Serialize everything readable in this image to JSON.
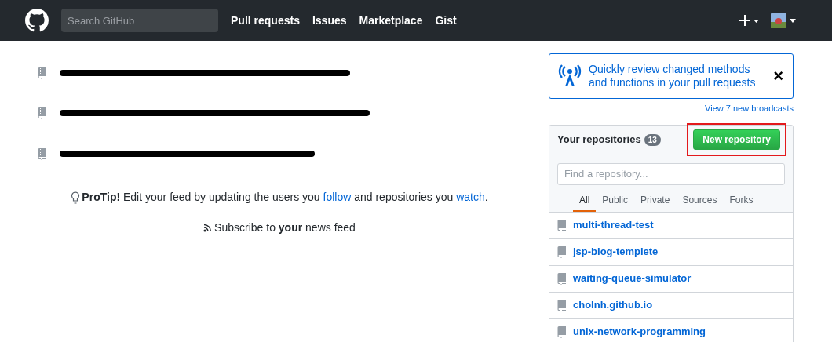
{
  "header": {
    "search": {
      "placeholder": "Search GitHub"
    },
    "nav": [
      "Pull requests",
      "Issues",
      "Marketplace",
      "Gist"
    ]
  },
  "feed": {
    "items": [
      {
        "redacted": true
      },
      {
        "redacted": true
      },
      {
        "redacted": true
      }
    ],
    "protip": {
      "lead": "**ProTip!** Edit your feed by updating the users you",
      "link1": "follow",
      "middle": "and repositories you",
      "link2": "watch",
      "end": "."
    },
    "subscribe": "Subscribe to **your** news feed"
  },
  "broadcast": {
    "text": "Quickly review changed methods and functions in your pull requests",
    "close": "×",
    "more": "View 7 new broadcasts"
  },
  "repos": {
    "title": "Your repositories",
    "count": "13",
    "new_button": "New repository",
    "new_button_highlighted": true,
    "filter": {
      "placeholder": "Find a repository..."
    },
    "tabs": [
      {
        "label": "All",
        "selected": true
      },
      {
        "label": "Public",
        "selected": false
      },
      {
        "label": "Private",
        "selected": false
      },
      {
        "label": "Sources",
        "selected": false
      },
      {
        "label": "Forks",
        "selected": false
      }
    ],
    "items": [
      "multi-thread-test",
      "jsp-blog-templete",
      "waiting-queue-simulator",
      "cholnh.github.io",
      "unix-network-programming"
    ]
  }
}
